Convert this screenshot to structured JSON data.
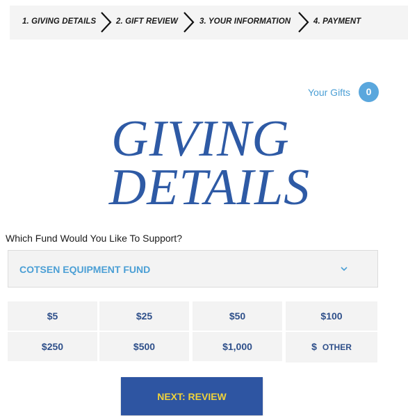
{
  "steps": [
    {
      "label": "1. GIVING DETAILS"
    },
    {
      "label": "2. GIFT REVIEW"
    },
    {
      "label": "3. YOUR INFORMATION"
    },
    {
      "label": "4. PAYMENT"
    }
  ],
  "gifts": {
    "label": "Your Gifts",
    "count": "0"
  },
  "page_title": {
    "line1": "GIVING",
    "line2": "DETAILS"
  },
  "fund": {
    "question": "Which Fund Would You Like To Support?",
    "selected": "COTSEN EQUIPMENT FUND",
    "icon": "chevron-down-icon"
  },
  "amounts": [
    "$5",
    "$25",
    "$50",
    "$100",
    "$250",
    "$500",
    "$1,000"
  ],
  "other": {
    "currency": "$",
    "label": "OTHER"
  },
  "next_button": {
    "label": "NEXT: REVIEW"
  },
  "colors": {
    "brand_blue": "#2e55a2",
    "accent_light_blue": "#4b9fd5",
    "button_text_yellow": "#f0d33a",
    "step_bar_bg": "#f4f4f4"
  }
}
